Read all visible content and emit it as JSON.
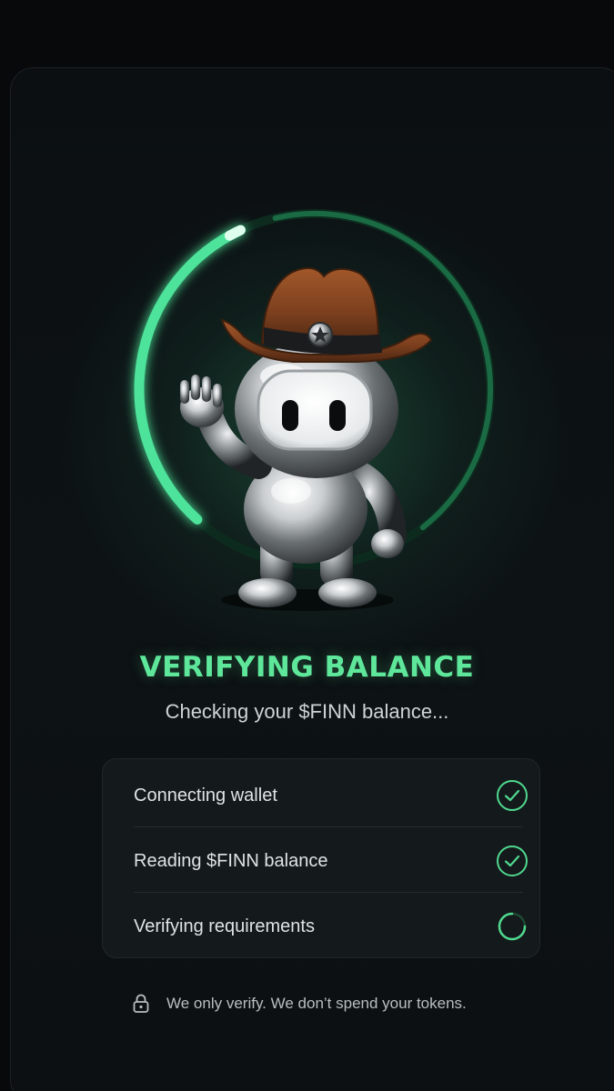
{
  "status": {
    "title": "VERIFYING BALANCE",
    "subtitle": "Checking your $FINN balance...",
    "progress_fraction": 0.62
  },
  "mascot": {
    "icon": "cowboy-robot-mascot"
  },
  "steps": [
    {
      "label": "Connecting wallet",
      "state": "done",
      "icon": "check-circle-icon"
    },
    {
      "label": "Reading $FINN balance",
      "state": "done",
      "icon": "check-circle-icon"
    },
    {
      "label": "Verifying requirements",
      "state": "in-progress",
      "icon": "spinner-icon"
    }
  ],
  "footer": {
    "icon": "lock-icon",
    "text": "We only verify. We don’t spend your tokens."
  },
  "colors": {
    "accent": "#5ee79a",
    "background": "#07090b"
  }
}
